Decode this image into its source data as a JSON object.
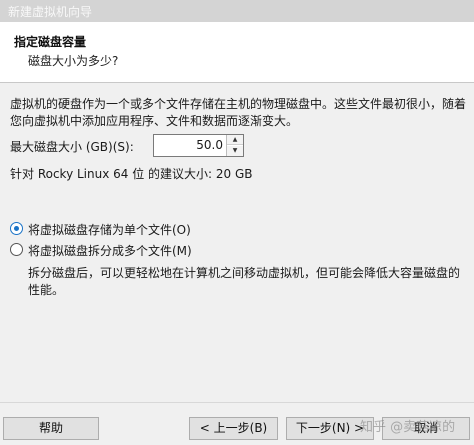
{
  "window": {
    "title": "新建虚拟机向导"
  },
  "header": {
    "title": "指定磁盘容量",
    "subtitle": "磁盘大小为多少?"
  },
  "content": {
    "description": "虚拟机的硬盘作为一个或多个文件存储在主机的物理磁盘中。这些文件最初很小，随着您向虚拟机中添加应用程序、文件和数据而逐渐变大。",
    "max_size_label": "最大磁盘大小 (GB)(S):",
    "max_size_value": "50.0",
    "recommended": "针对 Rocky Linux 64 位 的建议大小: 20 GB",
    "option_single": "将虚拟磁盘存储为单个文件(O)",
    "option_split": "将虚拟磁盘拆分成多个文件(M)",
    "split_description": "拆分磁盘后，可以更轻松地在计算机之间移动虚拟机，但可能会降低大容量磁盘的性能。",
    "selected_option": "single"
  },
  "footer": {
    "help": "帮助",
    "prev": "< 上一步(B)",
    "next": "下一步(N) >",
    "cancel": "取消"
  },
  "watermark": "知乎 @卖菇凉的"
}
